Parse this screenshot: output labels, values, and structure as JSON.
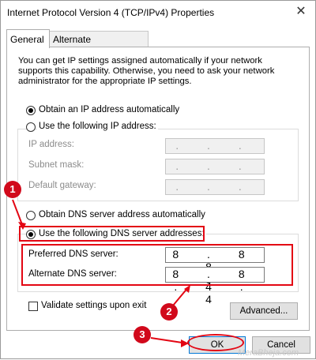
{
  "window": {
    "title": "Internet Protocol Version 4 (TCP/IPv4) Properties",
    "close_glyph": "✕"
  },
  "tabs": [
    {
      "label": "General",
      "active": true
    },
    {
      "label": "Alternate Configuration",
      "active": false
    }
  ],
  "intro_text": "You can get IP settings assigned automatically if your network supports this capability. Otherwise, you need to ask your network administrator for the appropriate IP settings.",
  "ip_section": {
    "obtain_auto_label": "Obtain an IP address automatically",
    "use_following_label": "Use the following IP address:",
    "fields": [
      {
        "label": "IP address:",
        "value": ". . ."
      },
      {
        "label": "Subnet mask:",
        "value": ". . ."
      },
      {
        "label": "Default gateway:",
        "value": ". . ."
      }
    ],
    "selected": "obtain_auto"
  },
  "dns_section": {
    "obtain_auto_label": "Obtain DNS server address automatically",
    "use_following_label": "Use the following DNS server addresses:",
    "selected": "use_following",
    "preferred_label": "Preferred DNS server:",
    "preferred_value": "8 . 8 . 8 . 8",
    "alternate_label": "Alternate DNS server:",
    "alternate_value": "8 . 8 . 4 . 4"
  },
  "validate_label": "Validate settings upon exit",
  "validate_checked": false,
  "buttons": {
    "advanced": "Advanced...",
    "ok": "OK",
    "cancel": "Cancel"
  },
  "annotations": {
    "step1": "1",
    "step2": "2",
    "step3": "3",
    "color": "#e30613"
  },
  "watermark": "MeraBheja.com"
}
